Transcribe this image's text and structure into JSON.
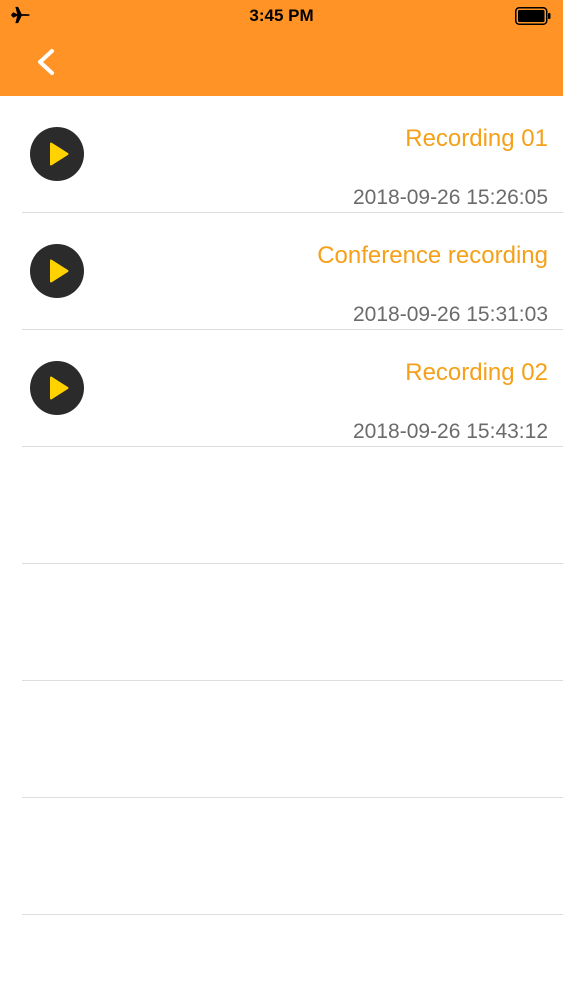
{
  "colors": {
    "accent": "#FF9326",
    "title_text": "#F5A019",
    "play_bg": "#2B2B2B",
    "play_triangle": "#FFD200"
  },
  "status_bar": {
    "time": "3:45 PM",
    "left_icon": "airplane-icon",
    "right_icon": "battery-icon"
  },
  "nav": {
    "back_icon": "chevron-left-icon"
  },
  "recordings": [
    {
      "title": "Recording  01",
      "timestamp": "2018-09-26 15:26:05"
    },
    {
      "title": "Conference recording",
      "timestamp": "2018-09-26 15:31:03"
    },
    {
      "title": "Recording 02",
      "timestamp": "2018-09-26 15:43:12"
    }
  ],
  "empty_rows": 4
}
